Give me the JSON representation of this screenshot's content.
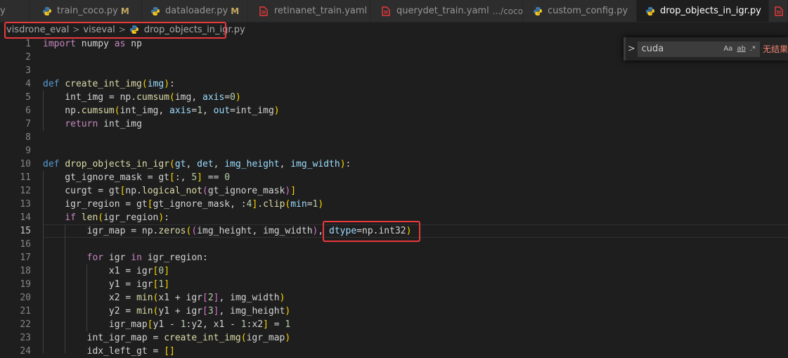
{
  "tabs": [
    {
      "label": "y",
      "icon": "none"
    },
    {
      "label": "train_coco.py",
      "modified": "M",
      "icon": "python-icon"
    },
    {
      "label": "dataloader.py",
      "modified": "M",
      "icon": "python-icon"
    },
    {
      "label": "retinanet_train.yaml",
      "icon": "yaml-icon"
    },
    {
      "label": "querydet_train.yaml",
      "description": ".../coco",
      "icon": "yaml-icon"
    },
    {
      "label": "custom_config.py",
      "icon": "python-icon"
    },
    {
      "label": "drop_objects_in_igr.py",
      "icon": "python-icon",
      "active": true
    }
  ],
  "breadcrumb": [
    "visdrone_eval",
    "viseval",
    "drop_objects_in_igr.py"
  ],
  "find_widget": {
    "value": "cuda",
    "match_case": "Aa",
    "whole_word": "ab",
    "regex": ".*",
    "result": "无结果"
  },
  "editor": {
    "current_line": 15,
    "line_numbers": [
      "1",
      "2",
      "3",
      "4",
      "5",
      "6",
      "7",
      "8",
      "9",
      "10",
      "11",
      "12",
      "13",
      "14",
      "15",
      "16",
      "17",
      "18",
      "19",
      "20",
      "21",
      "22",
      "23",
      "24"
    ]
  },
  "colors": {
    "keyword": "#569cd6",
    "control": "#c586c0",
    "function": "#dcdcaa",
    "variable": "#9cdcfe",
    "number": "#b5cea8",
    "annotation": "#e8393c"
  },
  "code_lines": [
    [
      {
        "t": "import",
        "c": "ctl"
      },
      {
        "t": " numpy "
      },
      {
        "t": "as",
        "c": "ctl"
      },
      {
        "t": " np"
      }
    ],
    [],
    [],
    [
      {
        "t": "def",
        "c": "kw"
      },
      {
        "t": " "
      },
      {
        "t": "create_int_img",
        "c": "fn"
      },
      {
        "t": "(",
        "c": "p1"
      },
      {
        "t": "img",
        "c": "id"
      },
      {
        "t": ")",
        "c": "p1"
      },
      {
        "t": ":"
      }
    ],
    [
      {
        "t": "    int_img = np."
      },
      {
        "t": "cumsum",
        "c": "fn"
      },
      {
        "t": "(",
        "c": "p1"
      },
      {
        "t": "img, "
      },
      {
        "t": "axis",
        "c": "id"
      },
      {
        "t": "="
      },
      {
        "t": "0",
        "c": "num"
      },
      {
        "t": ")",
        "c": "p1"
      }
    ],
    [
      {
        "t": "    np."
      },
      {
        "t": "cumsum",
        "c": "fn"
      },
      {
        "t": "(",
        "c": "p1"
      },
      {
        "t": "int_img, "
      },
      {
        "t": "axis",
        "c": "id"
      },
      {
        "t": "="
      },
      {
        "t": "1",
        "c": "num"
      },
      {
        "t": ", "
      },
      {
        "t": "out",
        "c": "id"
      },
      {
        "t": "=int_img"
      },
      {
        "t": ")",
        "c": "p1"
      }
    ],
    [
      {
        "t": "    "
      },
      {
        "t": "return",
        "c": "ctl"
      },
      {
        "t": " int_img"
      }
    ],
    [],
    [],
    [
      {
        "t": "def",
        "c": "kw"
      },
      {
        "t": " "
      },
      {
        "t": "drop_objects_in_igr",
        "c": "fn"
      },
      {
        "t": "(",
        "c": "p1"
      },
      {
        "t": "gt",
        "c": "id"
      },
      {
        "t": ", "
      },
      {
        "t": "det",
        "c": "id"
      },
      {
        "t": ", "
      },
      {
        "t": "img_height",
        "c": "id"
      },
      {
        "t": ", "
      },
      {
        "t": "img_width",
        "c": "id"
      },
      {
        "t": ")",
        "c": "p1"
      },
      {
        "t": ":"
      }
    ],
    [
      {
        "t": "    gt_ignore_mask = gt"
      },
      {
        "t": "[",
        "c": "p1"
      },
      {
        "t": ":, "
      },
      {
        "t": "5",
        "c": "num"
      },
      {
        "t": "]",
        "c": "p1"
      },
      {
        "t": " == "
      },
      {
        "t": "0",
        "c": "num"
      }
    ],
    [
      {
        "t": "    curgt = gt"
      },
      {
        "t": "[",
        "c": "p1"
      },
      {
        "t": "np."
      },
      {
        "t": "logical_not",
        "c": "fn"
      },
      {
        "t": "(",
        "c": "p2"
      },
      {
        "t": "gt_ignore_mask"
      },
      {
        "t": ")",
        "c": "p2"
      },
      {
        "t": "]",
        "c": "p1"
      }
    ],
    [
      {
        "t": "    igr_region = gt"
      },
      {
        "t": "[",
        "c": "p1"
      },
      {
        "t": "gt_ignore_mask, :"
      },
      {
        "t": "4",
        "c": "num"
      },
      {
        "t": "]",
        "c": "p1"
      },
      {
        "t": "."
      },
      {
        "t": "clip",
        "c": "fn"
      },
      {
        "t": "(",
        "c": "p1"
      },
      {
        "t": "min",
        "c": "id"
      },
      {
        "t": "="
      },
      {
        "t": "1",
        "c": "num"
      },
      {
        "t": ")",
        "c": "p1"
      }
    ],
    [
      {
        "t": "    "
      },
      {
        "t": "if",
        "c": "ctl"
      },
      {
        "t": " "
      },
      {
        "t": "len",
        "c": "fn"
      },
      {
        "t": "(",
        "c": "p1"
      },
      {
        "t": "igr_region"
      },
      {
        "t": ")",
        "c": "p1"
      },
      {
        "t": ":"
      }
    ],
    [
      {
        "t": "        igr_map = np."
      },
      {
        "t": "zeros",
        "c": "fn"
      },
      {
        "t": "(",
        "c": "p1"
      },
      {
        "t": "(",
        "c": "p2"
      },
      {
        "t": "img_height, img_width"
      },
      {
        "t": ")",
        "c": "p2"
      },
      {
        "t": ", "
      },
      {
        "t": "dtype",
        "c": "id"
      },
      {
        "t": "=np.int32"
      },
      {
        "t": ")",
        "c": "p1"
      }
    ],
    [],
    [
      {
        "t": "        "
      },
      {
        "t": "for",
        "c": "ctl"
      },
      {
        "t": " igr "
      },
      {
        "t": "in",
        "c": "ctl"
      },
      {
        "t": " igr_region:"
      }
    ],
    [
      {
        "t": "            x1 = igr"
      },
      {
        "t": "[",
        "c": "p1"
      },
      {
        "t": "0",
        "c": "num"
      },
      {
        "t": "]",
        "c": "p1"
      }
    ],
    [
      {
        "t": "            y1 = igr"
      },
      {
        "t": "[",
        "c": "p1"
      },
      {
        "t": "1",
        "c": "num"
      },
      {
        "t": "]",
        "c": "p1"
      }
    ],
    [
      {
        "t": "            x2 = "
      },
      {
        "t": "min",
        "c": "fn"
      },
      {
        "t": "(",
        "c": "p1"
      },
      {
        "t": "x1 + igr"
      },
      {
        "t": "[",
        "c": "p2"
      },
      {
        "t": "2",
        "c": "num"
      },
      {
        "t": "]",
        "c": "p2"
      },
      {
        "t": ", img_width"
      },
      {
        "t": ")",
        "c": "p1"
      }
    ],
    [
      {
        "t": "            y2 = "
      },
      {
        "t": "min",
        "c": "fn"
      },
      {
        "t": "(",
        "c": "p1"
      },
      {
        "t": "y1 + igr"
      },
      {
        "t": "[",
        "c": "p2"
      },
      {
        "t": "3",
        "c": "num"
      },
      {
        "t": "]",
        "c": "p2"
      },
      {
        "t": ", img_height"
      },
      {
        "t": ")",
        "c": "p1"
      }
    ],
    [
      {
        "t": "            igr_map"
      },
      {
        "t": "[",
        "c": "p1"
      },
      {
        "t": "y1 - "
      },
      {
        "t": "1",
        "c": "num"
      },
      {
        "t": ":y2, x1 - "
      },
      {
        "t": "1",
        "c": "num"
      },
      {
        "t": ":x2"
      },
      {
        "t": "]",
        "c": "p1"
      },
      {
        "t": " = "
      },
      {
        "t": "1",
        "c": "num"
      }
    ],
    [
      {
        "t": "        int_igr_map = "
      },
      {
        "t": "create_int_img",
        "c": "fn"
      },
      {
        "t": "(",
        "c": "p1"
      },
      {
        "t": "igr_map"
      },
      {
        "t": ")",
        "c": "p1"
      }
    ],
    [
      {
        "t": "        idx_left_gt = "
      },
      {
        "t": "[]",
        "c": "p1"
      }
    ]
  ]
}
